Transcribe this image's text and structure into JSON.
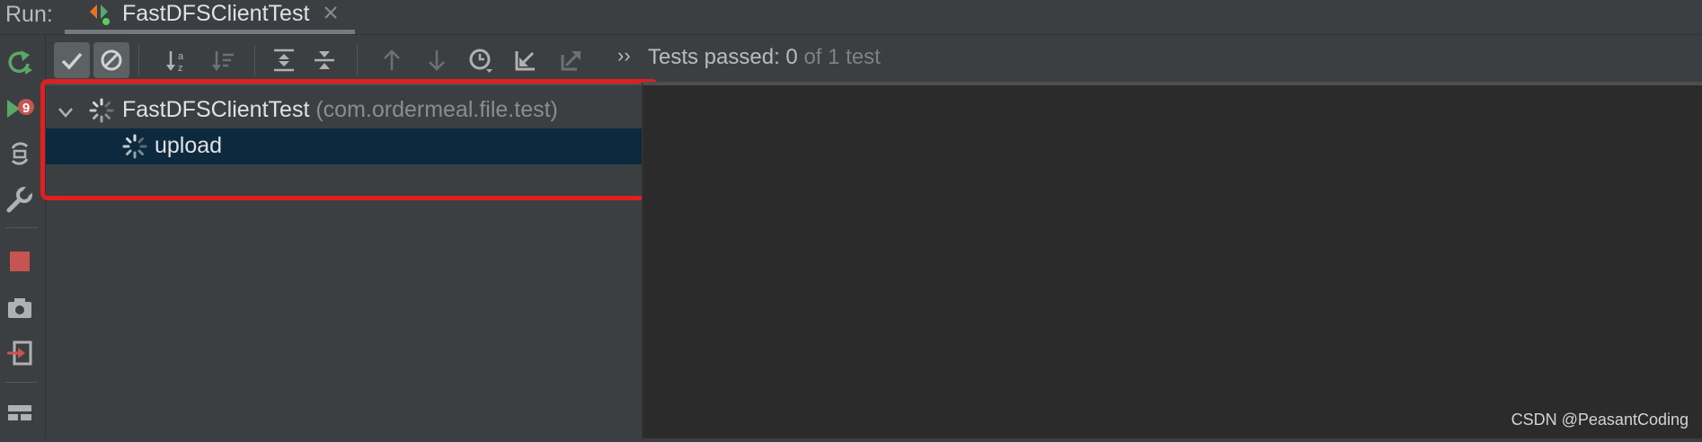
{
  "run_bar": {
    "label": "Run:",
    "tab": {
      "title": "FastDFSClientTest",
      "icon": "junit-run-config-icon"
    }
  },
  "left_toolbar": {
    "buttons": [
      {
        "name": "rerun-icon"
      },
      {
        "name": "rerun-failed-icon"
      },
      {
        "name": "toggle-auto-test-icon"
      },
      {
        "name": "settings-wrench-icon"
      },
      {
        "name": "stop-icon"
      },
      {
        "name": "screenshot-camera-icon"
      },
      {
        "name": "import-tests-icon"
      },
      {
        "name": "layout-icon"
      }
    ]
  },
  "toolbar": {
    "show_passed": {
      "name": "check-icon",
      "toggled": true
    },
    "show_ignored": {
      "name": "ignored-icon",
      "toggled": true
    },
    "sort_alpha": {
      "name": "sort-alpha-icon"
    },
    "sort_duration": {
      "name": "sort-duration-icon"
    },
    "expand_all": {
      "name": "expand-all-icon"
    },
    "collapse_all": {
      "name": "collapse-all-icon"
    },
    "prev_failed": {
      "name": "arrow-up-icon"
    },
    "next_failed": {
      "name": "arrow-down-icon"
    },
    "history": {
      "name": "history-clock-icon"
    },
    "import_results": {
      "name": "import-results-icon"
    },
    "export_results": {
      "name": "export-results-icon"
    },
    "more": "››"
  },
  "status": {
    "prefix": "Tests passed: ",
    "passed": "0",
    "suffix": " of 1 test"
  },
  "tree": {
    "root": {
      "name": "FastDFSClientTest",
      "package": "(com.ordermeal.file.test)"
    },
    "children": [
      {
        "name": "upload",
        "selected": true
      }
    ]
  },
  "watermark": "CSDN @PeasantCoding",
  "colors": {
    "background": "#3c3f41",
    "console": "#2b2b2b",
    "selection": "#0d293e",
    "highlight": "#e02020",
    "rerun_green": "#59a869",
    "stop_red": "#c75450"
  }
}
